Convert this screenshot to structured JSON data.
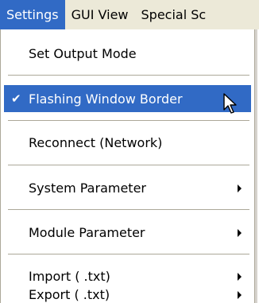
{
  "menubar": {
    "items": [
      "Settings",
      "GUI View",
      "Special Sc"
    ]
  },
  "menu": {
    "set_output_mode": "Set Output Mode",
    "flashing_border": "Flashing Window Border",
    "check_mark": "✔",
    "reconnect": "Reconnect (Network)",
    "system_parameter": "System Parameter",
    "module_parameter": "Module Parameter",
    "import": "Import ( .txt)",
    "export": "Export ( .txt)"
  },
  "colors": {
    "highlight": "#316ac5",
    "menubar": "#ece9d8"
  }
}
